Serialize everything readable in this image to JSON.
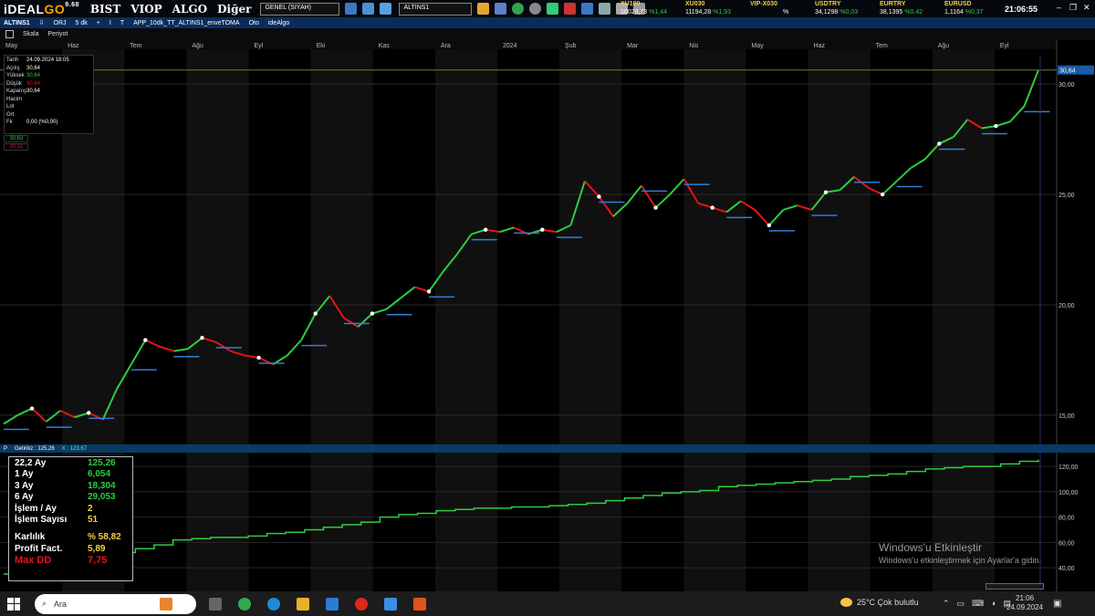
{
  "app": {
    "logo_main": "iDEAL",
    "logo_go": "GO",
    "version": "9.68",
    "menu": [
      "BIST",
      "VIOP",
      "ALGO",
      "Diğer"
    ],
    "theme_select": "GENEL (SIYAH)",
    "symbol_input": "ALTINS1",
    "clock": "21:06:55"
  },
  "tickers": [
    {
      "name": "XU100",
      "value": "10029,73",
      "change": "%1,44"
    },
    {
      "name": "XU030",
      "value": "11194,28",
      "change": "%1,93"
    },
    {
      "name": "VIP-X030",
      "value": "",
      "change": "%"
    },
    {
      "name": "USDTRY",
      "value": "34,1298",
      "change": "%0,03"
    },
    {
      "name": "EURTRY",
      "value": "38,1395",
      "change": "%0,42"
    },
    {
      "name": "EURUSD",
      "value": "1,1164",
      "change": "%0,37"
    }
  ],
  "chart_tab": {
    "symbol": "ALTINS1",
    "mode": "ORJ",
    "period": "5 dk",
    "indicator_flag": "I",
    "type_flag": "T",
    "system": "APP_10dk_TT_ALTINS1_enveTOMA",
    "auto": "Oto",
    "provider": "ideAlgo"
  },
  "toolbar2": {
    "scale": "Skala",
    "period": "Periyot"
  },
  "info_box": {
    "rows": [
      {
        "k": "Tarih",
        "v": "24.09.2024 18:05"
      },
      {
        "k": "Açılış",
        "v": "30,64"
      },
      {
        "k": "Yüksek",
        "v": "30,64"
      },
      {
        "k": "Düşük",
        "v": "30,64"
      },
      {
        "k": "Kapanış",
        "v": "30,64"
      },
      {
        "k": "Hacim",
        "v": ""
      },
      {
        "k": "Lot",
        "v": ""
      },
      {
        "k": "Ort",
        "v": ""
      },
      {
        "k": "Fk",
        "v": "0,00 (%0,00)"
      }
    ],
    "level_green": ": 30,63",
    "level_red": ": 30,32"
  },
  "colors": {
    "up": "#2ecc40",
    "down": "#e8121a",
    "baseline": "#2f7fd3",
    "equity": "#2ecc40",
    "accent": "#f5d142"
  },
  "chart_data": [
    {
      "type": "line",
      "title": "ALTINS1",
      "x_months": [
        "May",
        "Haz",
        "Tem",
        "Ağu",
        "Eyl",
        "Eki",
        "Kas",
        "Ara",
        "2024",
        "Şub",
        "Mar",
        "Nis",
        "May",
        "Haz",
        "Tem",
        "Ağu",
        "Eyl"
      ],
      "y_ticks": [
        "30,00",
        "25,00",
        "20,00",
        "15,00"
      ],
      "ylim": [
        14.0,
        31.0
      ],
      "last_value": "30,64",
      "series": [
        {
          "values": [
            14.6,
            15.0,
            15.3,
            14.7,
            15.2,
            14.9,
            15.1,
            14.8,
            16.2,
            17.3,
            18.4,
            18.1,
            17.9,
            18.0,
            18.5,
            18.3,
            17.9,
            17.7,
            17.6,
            17.3,
            17.7,
            18.4,
            19.6,
            20.4,
            19.4,
            19.0,
            19.6,
            19.8,
            20.3,
            20.8,
            20.6,
            21.5,
            22.3,
            23.2,
            23.4,
            23.3,
            23.5,
            23.2,
            23.4,
            23.3,
            23.6,
            25.6,
            24.9,
            24.0,
            24.6,
            25.4,
            24.4,
            25.0,
            25.7,
            24.6,
            24.4,
            24.2,
            24.7,
            24.3,
            23.6,
            24.3,
            24.5,
            24.3,
            25.1,
            25.2,
            25.8,
            25.3,
            25.0,
            25.6,
            26.2,
            26.6,
            27.3,
            27.6,
            28.4,
            28.0,
            28.1,
            28.3,
            29.0,
            30.64
          ]
        }
      ]
    },
    {
      "type": "line",
      "title": "Getiri",
      "y_ticks": [
        "120,00",
        "100,00",
        "80,00",
        "60,00",
        "40,00"
      ],
      "ylim": [
        30,
        128
      ],
      "series": [
        {
          "values": [
            35,
            36,
            37,
            39,
            41,
            44,
            52,
            55,
            58,
            62,
            63,
            64,
            64,
            65,
            67,
            68,
            70,
            72,
            74,
            76,
            80,
            82,
            83,
            85,
            86,
            87,
            87,
            88,
            88,
            89,
            90,
            91,
            93,
            95,
            97,
            99,
            100,
            101,
            104,
            105,
            106,
            107,
            108,
            109,
            110,
            112,
            113,
            114,
            116,
            118,
            119,
            120,
            120,
            122,
            124,
            125.26
          ]
        }
      ]
    }
  ],
  "midbar": {
    "p": "P",
    "getiri": "Getirikz : 125,26",
    "x": "X : 123,67"
  },
  "stats": [
    {
      "k": "22,2 Ay",
      "v": "125,26",
      "c": "g"
    },
    {
      "k": "1 Ay",
      "v": "6,054",
      "c": "g"
    },
    {
      "k": "3 Ay",
      "v": "18,304",
      "c": "g"
    },
    {
      "k": "6 Ay",
      "v": "29,053",
      "c": "g"
    },
    {
      "k": "İşlem / Ay",
      "v": "2",
      "c": "y"
    },
    {
      "k": "İşlem Sayısı",
      "v": "51",
      "c": "y"
    },
    {
      "k": "Karlılık",
      "v": "% 58,82",
      "c": "y"
    },
    {
      "k": "Profit Fact.",
      "v": "5,89",
      "c": "y"
    },
    {
      "k": "Max DD",
      "v": "7,75",
      "c": "r"
    }
  ],
  "watermark": {
    "line1": "Windows'u Etkinleştir",
    "line2": "Windows'u etkinleştirmek için Ayarlar'a gidin."
  },
  "taskbar": {
    "search": "Ara",
    "weather": "25°C  Çok bulutlu",
    "time": "21:06",
    "date": "24.09.2024"
  }
}
